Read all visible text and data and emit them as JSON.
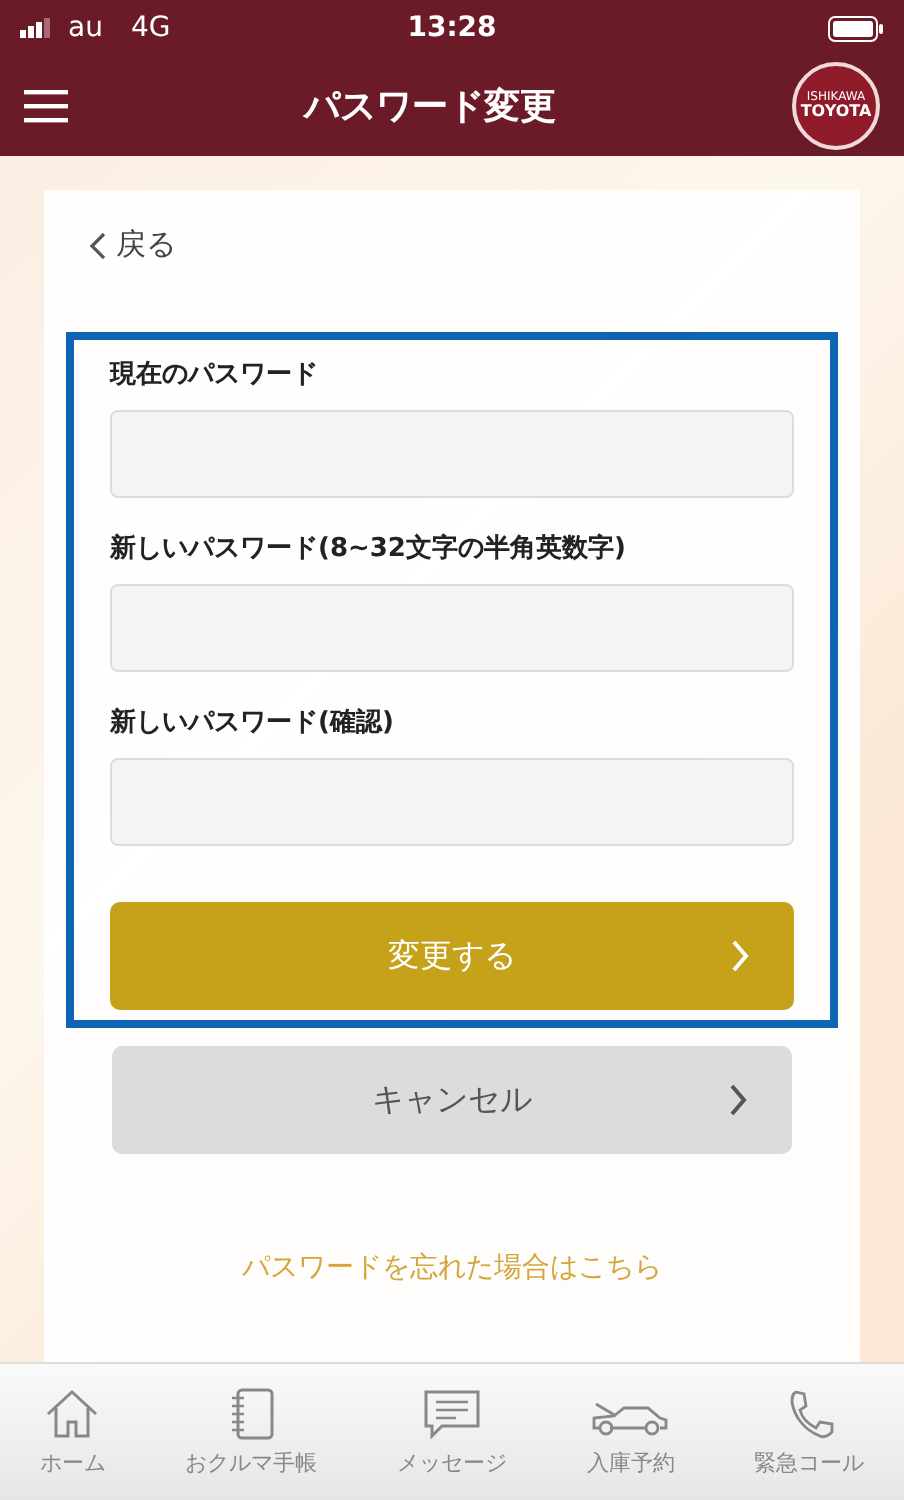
{
  "status_bar": {
    "carrier": "au",
    "network": "4G",
    "time": "13:28"
  },
  "header": {
    "title": "パスワード変更",
    "logo": {
      "top": "ISHIKAWA",
      "main": "TOYOTA"
    }
  },
  "back": {
    "label": "戻る"
  },
  "form": {
    "fields": [
      {
        "label": "現在のパスワード"
      },
      {
        "label": "新しいパスワード(8~32文字の半角英数字)"
      },
      {
        "label": "新しいパスワード(確認)"
      }
    ],
    "submit": "変更する"
  },
  "cancel": "キャンセル",
  "forgot_link": "パスワードを忘れた場合はこちら",
  "tab_bar": [
    {
      "kind": "home",
      "label": "ホーム"
    },
    {
      "kind": "notebook",
      "label": "おクルマ手帳"
    },
    {
      "kind": "message",
      "label": "メッセージ"
    },
    {
      "kind": "car",
      "label": "入庫予約"
    },
    {
      "kind": "phone",
      "label": "緊急コール"
    }
  ]
}
